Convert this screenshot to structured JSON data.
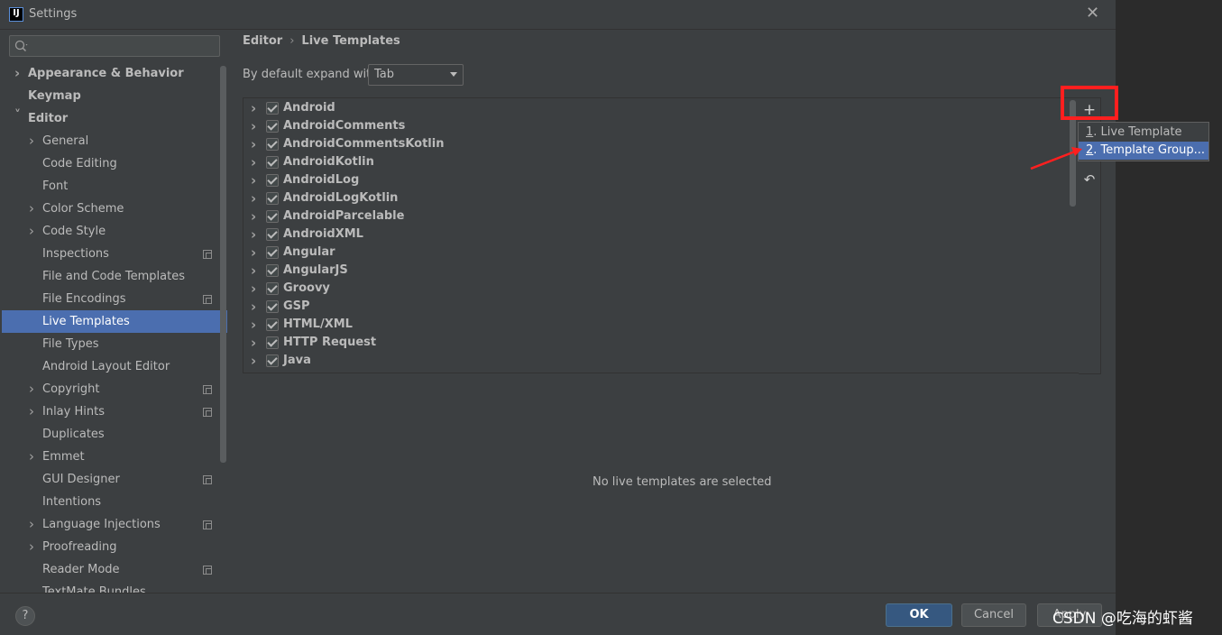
{
  "window": {
    "title": "Settings",
    "app_icon": "intellij-icon"
  },
  "search": {
    "placeholder": "Q˅",
    "value": ""
  },
  "sidebar": {
    "items": [
      {
        "label": "Appearance & Behavior",
        "level": 0,
        "bold": true,
        "expandable": true,
        "expanded": false,
        "project_icon": false,
        "selected": false
      },
      {
        "label": "Keymap",
        "level": 0,
        "bold": true,
        "expandable": false,
        "expanded": false,
        "project_icon": false,
        "selected": false
      },
      {
        "label": "Editor",
        "level": 0,
        "bold": true,
        "expandable": true,
        "expanded": true,
        "project_icon": false,
        "selected": false
      },
      {
        "label": "General",
        "level": 1,
        "bold": false,
        "expandable": true,
        "expanded": false,
        "project_icon": false,
        "selected": false
      },
      {
        "label": "Code Editing",
        "level": 1,
        "bold": false,
        "expandable": false,
        "expanded": false,
        "project_icon": false,
        "selected": false
      },
      {
        "label": "Font",
        "level": 1,
        "bold": false,
        "expandable": false,
        "expanded": false,
        "project_icon": false,
        "selected": false
      },
      {
        "label": "Color Scheme",
        "level": 1,
        "bold": false,
        "expandable": true,
        "expanded": false,
        "project_icon": false,
        "selected": false
      },
      {
        "label": "Code Style",
        "level": 1,
        "bold": false,
        "expandable": true,
        "expanded": false,
        "project_icon": false,
        "selected": false
      },
      {
        "label": "Inspections",
        "level": 1,
        "bold": false,
        "expandable": false,
        "expanded": false,
        "project_icon": true,
        "selected": false
      },
      {
        "label": "File and Code Templates",
        "level": 1,
        "bold": false,
        "expandable": false,
        "expanded": false,
        "project_icon": false,
        "selected": false
      },
      {
        "label": "File Encodings",
        "level": 1,
        "bold": false,
        "expandable": false,
        "expanded": false,
        "project_icon": true,
        "selected": false
      },
      {
        "label": "Live Templates",
        "level": 1,
        "bold": false,
        "expandable": false,
        "expanded": false,
        "project_icon": false,
        "selected": true
      },
      {
        "label": "File Types",
        "level": 1,
        "bold": false,
        "expandable": false,
        "expanded": false,
        "project_icon": false,
        "selected": false
      },
      {
        "label": "Android Layout Editor",
        "level": 1,
        "bold": false,
        "expandable": false,
        "expanded": false,
        "project_icon": false,
        "selected": false
      },
      {
        "label": "Copyright",
        "level": 1,
        "bold": false,
        "expandable": true,
        "expanded": false,
        "project_icon": true,
        "selected": false
      },
      {
        "label": "Inlay Hints",
        "level": 1,
        "bold": false,
        "expandable": true,
        "expanded": false,
        "project_icon": true,
        "selected": false
      },
      {
        "label": "Duplicates",
        "level": 1,
        "bold": false,
        "expandable": false,
        "expanded": false,
        "project_icon": false,
        "selected": false
      },
      {
        "label": "Emmet",
        "level": 1,
        "bold": false,
        "expandable": true,
        "expanded": false,
        "project_icon": false,
        "selected": false
      },
      {
        "label": "GUI Designer",
        "level": 1,
        "bold": false,
        "expandable": false,
        "expanded": false,
        "project_icon": true,
        "selected": false
      },
      {
        "label": "Intentions",
        "level": 1,
        "bold": false,
        "expandable": false,
        "expanded": false,
        "project_icon": false,
        "selected": false
      },
      {
        "label": "Language Injections",
        "level": 1,
        "bold": false,
        "expandable": true,
        "expanded": false,
        "project_icon": true,
        "selected": false
      },
      {
        "label": "Proofreading",
        "level": 1,
        "bold": false,
        "expandable": true,
        "expanded": false,
        "project_icon": false,
        "selected": false
      },
      {
        "label": "Reader Mode",
        "level": 1,
        "bold": false,
        "expandable": false,
        "expanded": false,
        "project_icon": true,
        "selected": false
      },
      {
        "label": "TextMate Bundles",
        "level": 1,
        "bold": false,
        "expandable": false,
        "expanded": false,
        "project_icon": false,
        "selected": false
      }
    ]
  },
  "breadcrumb": {
    "parent": "Editor",
    "separator": "›",
    "current": "Live Templates"
  },
  "expand": {
    "label": "By default expand with",
    "value": "Tab"
  },
  "templates": {
    "groups": [
      {
        "name": "Android",
        "checked": true
      },
      {
        "name": "AndroidComments",
        "checked": true
      },
      {
        "name": "AndroidCommentsKotlin",
        "checked": true
      },
      {
        "name": "AndroidKotlin",
        "checked": true
      },
      {
        "name": "AndroidLog",
        "checked": true
      },
      {
        "name": "AndroidLogKotlin",
        "checked": true
      },
      {
        "name": "AndroidParcelable",
        "checked": true
      },
      {
        "name": "AndroidXML",
        "checked": true
      },
      {
        "name": "Angular",
        "checked": true
      },
      {
        "name": "AngularJS",
        "checked": true
      },
      {
        "name": "Groovy",
        "checked": true
      },
      {
        "name": "GSP",
        "checked": true
      },
      {
        "name": "HTML/XML",
        "checked": true
      },
      {
        "name": "HTTP Request",
        "checked": true
      },
      {
        "name": "Java",
        "checked": true
      }
    ],
    "empty_message": "No live templates are selected"
  },
  "toolbar": {
    "add_icon": "+",
    "undo_icon": "↶"
  },
  "popup_menu": {
    "items": [
      {
        "mnemonic": "1",
        "label": ". Live Template",
        "selected": false
      },
      {
        "mnemonic": "2",
        "label": ". Template Group...",
        "selected": true
      }
    ]
  },
  "buttons": {
    "help": "?",
    "ok": "OK",
    "cancel": "Cancel",
    "apply": "Apply"
  },
  "watermark": "CSDN @吃海的虾酱",
  "colors": {
    "selection": "#4b6eaf",
    "highlight_box": "#ff1f1f",
    "background": "#3c3f41",
    "ok_button": "#365880"
  }
}
